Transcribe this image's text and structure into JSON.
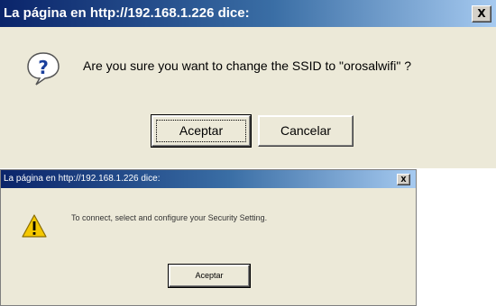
{
  "dialog1": {
    "title": "La página en http://192.168.1.226 dice:",
    "close_label": "X",
    "icon": "question-icon",
    "message": "Are you sure you want to change the SSID to \"orosalwifi\" ?",
    "ok_label": "Aceptar",
    "cancel_label": "Cancelar"
  },
  "dialog2": {
    "title": "La página en http://192.168.1.226 dice:",
    "close_label": "X",
    "icon": "warning-icon",
    "message": "To connect, select and configure your Security Setting.",
    "ok_label": "Aceptar"
  },
  "colors": {
    "titlebar_start": "#0a246a",
    "titlebar_end": "#a6caf0",
    "dialog_bg": "#ece9d8",
    "warning_yellow": "#f5c800"
  }
}
